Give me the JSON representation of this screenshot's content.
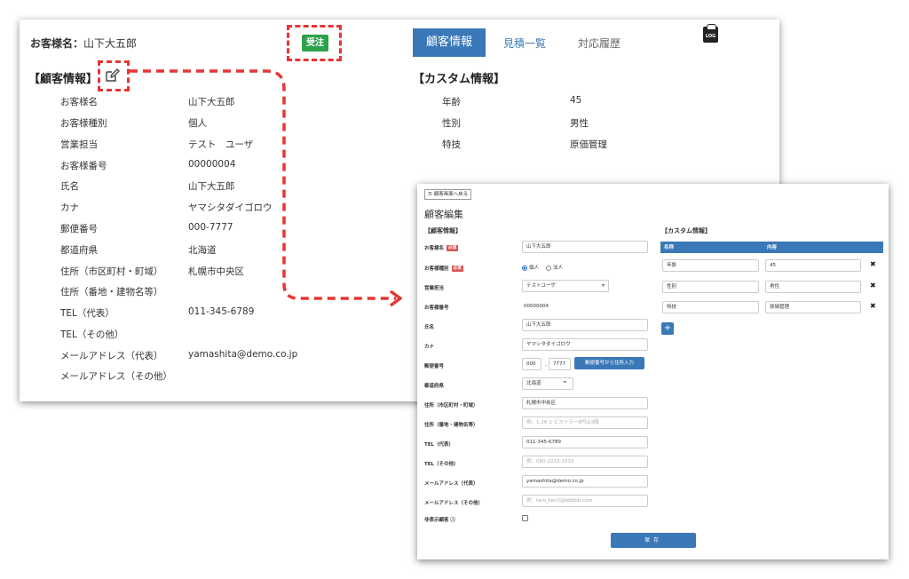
{
  "view": {
    "customer_name_label": "お客様名：",
    "customer_name_value": "山下大五郎",
    "order_badge": "受注",
    "tabs": [
      {
        "label": "顧客情報",
        "active": true
      },
      {
        "label": "見積一覧",
        "active": false
      },
      {
        "label": "対応履歴",
        "active": false
      }
    ],
    "log_icon_label": "LOG",
    "customer_section_title": "【顧客情報】",
    "custom_section_title": "【カスタム情報】",
    "fields": [
      {
        "label": "お客様名",
        "value": "山下大五郎"
      },
      {
        "label": "お客様種別",
        "value": "個人"
      },
      {
        "label": "営業担当",
        "value": "テスト　ユーザ"
      },
      {
        "label": "お客様番号",
        "value": "00000004"
      },
      {
        "label": "氏名",
        "value": "山下大五郎"
      },
      {
        "label": "カナ",
        "value": "ヤマシタダイゴロウ"
      },
      {
        "label": "郵便番号",
        "value": "000-7777"
      },
      {
        "label": "都道府県",
        "value": "北海道"
      },
      {
        "label": "住所（市区町村・町域）",
        "value": "札幌市中央区"
      },
      {
        "label": "住所（番地・建物名等）",
        "value": ""
      },
      {
        "label": "TEL（代表）",
        "value": "011-345-6789"
      },
      {
        "label": "TEL（その他）",
        "value": ""
      },
      {
        "label": "メールアドレス（代表）",
        "value": "yamashita@demo.co.jp"
      },
      {
        "label": "メールアドレス（その他）",
        "value": ""
      }
    ],
    "custom_fields": [
      {
        "label": "年齢",
        "value": "45"
      },
      {
        "label": "性別",
        "value": "男性"
      },
      {
        "label": "特技",
        "value": "原価管理"
      }
    ]
  },
  "edit": {
    "back_button": "顧客画面へ戻る",
    "title": "顧客編集",
    "customer_section_title": "【顧客情報】",
    "custom_section_title": "【カスタム情報】",
    "required_badge": "必須",
    "labels": {
      "name": "お客様名",
      "type": "お客様種別",
      "staff": "営業担当",
      "number": "お客様番号",
      "full_name": "氏名",
      "kana": "カナ",
      "zip": "郵便番号",
      "prefecture": "都道府県",
      "address1": "住所（市区町村・町域）",
      "address2": "住所（番地・建物名等）",
      "tel_main": "TEL（代表）",
      "tel_other": "TEL（その他）",
      "email_main": "メールアドレス（代表）",
      "email_other": "メールアドレス（その他）",
      "hidden": "非表示顧客 ⓘ"
    },
    "values": {
      "name": "山下大五郎",
      "type_options": [
        "個人",
        "法人"
      ],
      "type_selected": "個人",
      "staff": "テストユーザ",
      "number": "00000004",
      "full_name": "山下大五郎",
      "kana": "ヤマシタダイゴロウ",
      "zip1": "000",
      "zip2": "7777",
      "zip_dash": "-",
      "zip_lookup_button": "郵便番号から住所入力",
      "prefecture": "北海道",
      "address1": "札幌市中央区",
      "address2_placeholder": "例：1-26-1 ビストラー8円山3階",
      "tel_main": "011-345-6789",
      "tel_other_placeholder": "例：080-2222-3333",
      "email_main": "yamashita@demo.co.jp",
      "email_other_placeholder": "例：taro_ken2@bbbbb.com",
      "hidden_checked": false
    },
    "custom_table": {
      "headers": [
        "名称",
        "内容"
      ],
      "rows": [
        {
          "name": "年齢",
          "value": "45"
        },
        {
          "name": "性別",
          "value": "男性"
        },
        {
          "name": "特技",
          "value": "原価管理"
        }
      ],
      "delete_symbol": "✖",
      "add_symbol": "+"
    },
    "save_button": "保存"
  },
  "colors": {
    "accent": "#3a78b8",
    "order_badge": "#2da14b",
    "highlight_dashed": "#e53535",
    "required_badge": "#d9534f"
  }
}
